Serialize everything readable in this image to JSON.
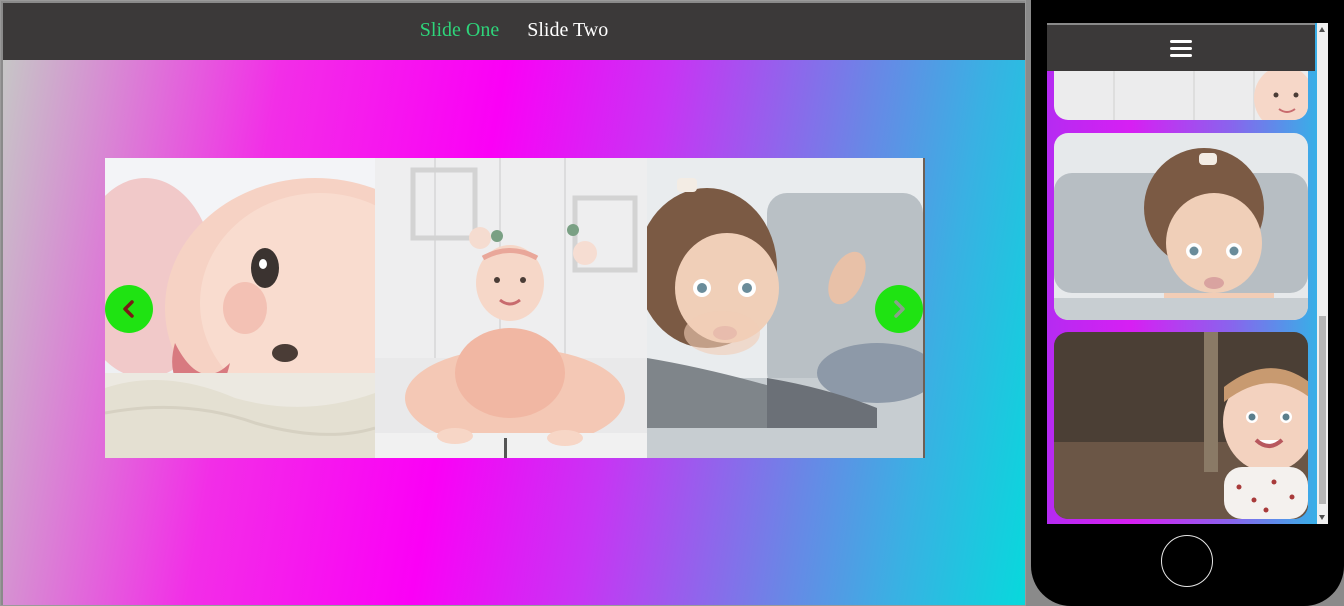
{
  "nav": {
    "links": [
      {
        "label": "Slide One",
        "color": "#2ed47a",
        "active": true
      },
      {
        "label": "Slide Two",
        "color": "#ffffff",
        "active": false
      }
    ]
  },
  "carousel": {
    "slides": [
      {
        "image": "baby-smiling-closeup"
      },
      {
        "image": "baby-girl-pink-tutu"
      },
      {
        "image": "toddler-curly-hair-on-sofa"
      }
    ],
    "prev_icon": "chevron-left-icon",
    "next_icon": "chevron-right-icon",
    "arrow_color": "#1fe312"
  },
  "phone": {
    "menu_icon": "hamburger-icon",
    "cards": [
      {
        "image": "baby-girl-pink-tutu"
      },
      {
        "image": "toddler-curly-hair-on-sofa"
      },
      {
        "image": "baby-smiling-striped-shirt"
      }
    ]
  },
  "colors": {
    "navbar": "#3b3939",
    "gradient": [
      "#c6c6c6",
      "#fb00f6",
      "#07d9dc"
    ]
  }
}
